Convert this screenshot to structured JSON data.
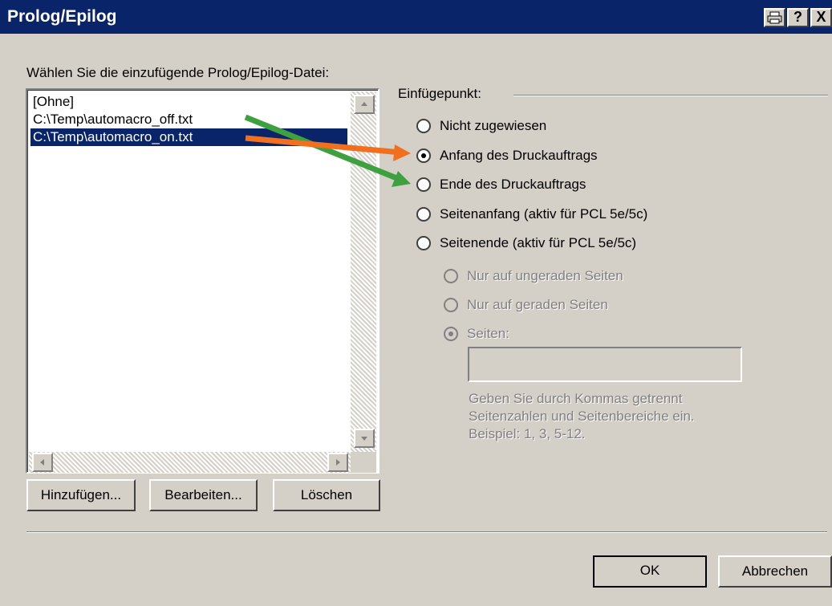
{
  "window": {
    "title": "Prolog/Epilog",
    "buttons": {
      "print": "⎙",
      "help": "?",
      "close": "X"
    }
  },
  "list": {
    "label": "Wählen Sie die einzufügende Prolog/Epilog-Datei:",
    "items": [
      "[Ohne]",
      "C:\\Temp\\automacro_off.txt",
      "C:\\Temp\\automacro_on.txt"
    ],
    "selected_index": 2
  },
  "list_buttons": {
    "add": "Hinzufügen...",
    "edit": "Bearbeiten...",
    "delete": "Löschen"
  },
  "insert_point": {
    "group_label": "Einfügepunkt:",
    "options": [
      {
        "label": "Nicht zugewiesen",
        "checked": false,
        "enabled": true
      },
      {
        "label": "Anfang des Druckauftrags",
        "checked": true,
        "enabled": true
      },
      {
        "label": "Ende des Druckauftrags",
        "checked": false,
        "enabled": true
      },
      {
        "label": "Seitenanfang (aktiv für PCL 5e/5c)",
        "checked": false,
        "enabled": true
      },
      {
        "label": "Seitenende (aktiv für PCL 5e/5c)",
        "checked": false,
        "enabled": true
      }
    ],
    "sub_options": [
      {
        "label": "Nur auf ungeraden Seiten",
        "checked": false,
        "enabled": false
      },
      {
        "label": "Nur auf geraden Seiten",
        "checked": false,
        "enabled": false
      },
      {
        "label": "Seiten:",
        "checked": true,
        "enabled": false
      }
    ],
    "pages_value": "",
    "hint_lines": [
      "Geben Sie durch Kommas getrennt",
      "Seitenzahlen und Seitenbereiche ein.",
      "Beispiel: 1, 3, 5-12."
    ]
  },
  "dialog_buttons": {
    "ok": "OK",
    "cancel": "Abbrechen"
  },
  "annotation_colors": {
    "orange": "#f07020",
    "green": "#3fa03f",
    "title_bar": "#0a246a",
    "face": "#d4d0c8"
  }
}
